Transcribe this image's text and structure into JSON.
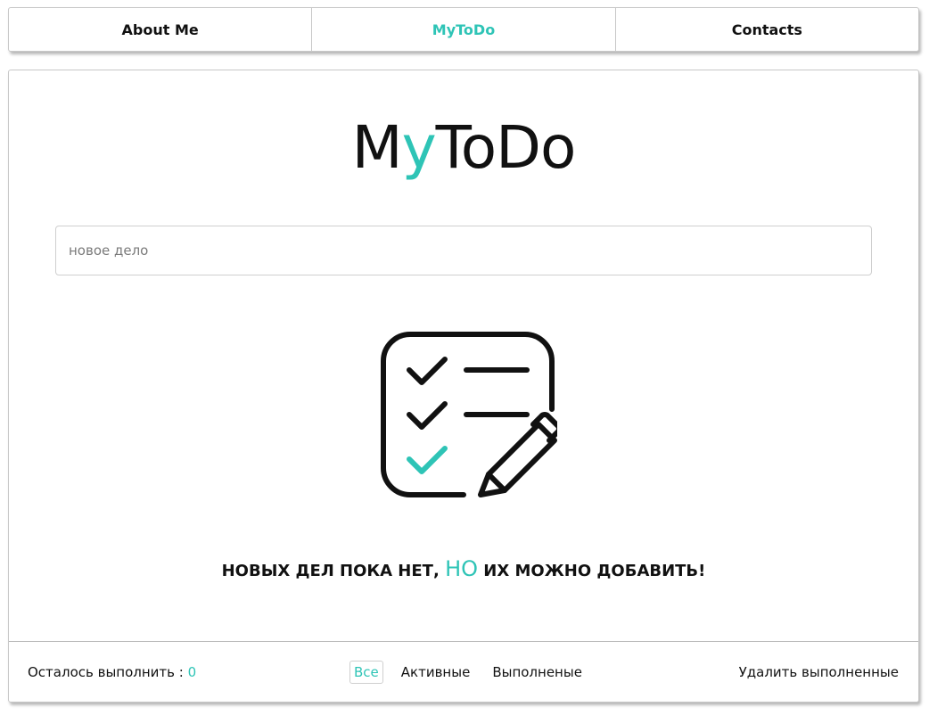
{
  "nav": {
    "items": [
      {
        "label": "About Me"
      },
      {
        "label": "MyToDo"
      },
      {
        "label": "Contacts"
      }
    ],
    "active_index": 1
  },
  "logo": {
    "part1": "M",
    "accent": "y",
    "part2": "ToDo"
  },
  "input": {
    "placeholder": "новое дело",
    "value": ""
  },
  "empty_state": {
    "text_before": "НОВЫХ ДЕЛ ПОКА НЕТ,",
    "accent": "НО",
    "text_after": "ИХ МОЖНО ДОБАВИТЬ!",
    "icon": "checklist-pencil-icon"
  },
  "footer": {
    "remaining_label": "Осталось выполнить :",
    "remaining_count": "0",
    "filters": [
      "Все",
      "Активные",
      "Выполненые"
    ],
    "active_filter": 0,
    "clear_label": "Удалить выполненные"
  },
  "colors": {
    "accent": "#2ec4b6",
    "text": "#111111",
    "border": "#c8c8c8"
  }
}
